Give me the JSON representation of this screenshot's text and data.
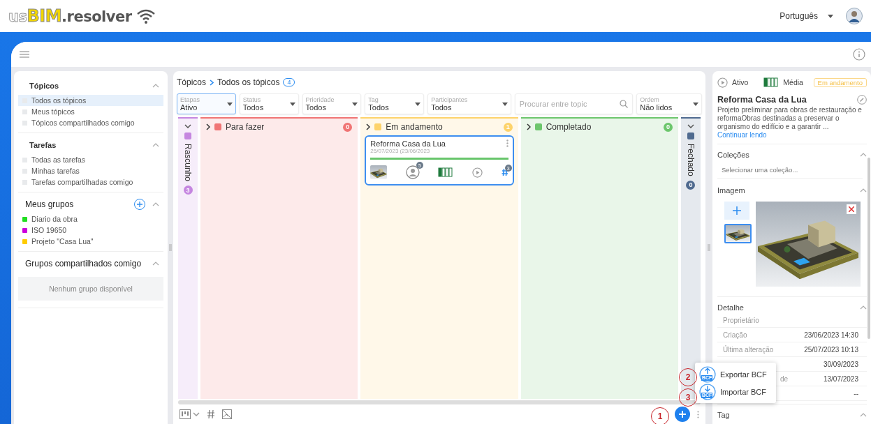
{
  "header": {
    "logo": {
      "prefix": "us",
      "brand": "BIM",
      "suffix": ".resolver"
    },
    "language": "Português"
  },
  "sidebar": {
    "sections": [
      {
        "title": "Tópicos",
        "items": [
          {
            "label": "Todos os tópicos",
            "selected": true
          },
          {
            "label": "Meus tópicos",
            "selected": false
          },
          {
            "label": "Tópicos compartilhados comigo",
            "selected": false
          }
        ]
      },
      {
        "title": "Tarefas",
        "items": [
          {
            "label": "Todas as tarefas",
            "selected": false
          },
          {
            "label": "Minhas tarefas",
            "selected": false
          },
          {
            "label": "Tarefas compartilhadas comigo",
            "selected": false
          }
        ]
      }
    ],
    "groups": {
      "title": "Meus grupos",
      "items": [
        {
          "label": "Diario da obra",
          "color": "#22dd22"
        },
        {
          "label": "ISO 19650",
          "color": "#cc00dd"
        },
        {
          "label": "Projeto \"Casa Lua\"",
          "color": "#ffcc00"
        }
      ]
    },
    "shared": {
      "title": "Grupos compartilhados comigo",
      "empty": "Nenhum grupo disponível"
    }
  },
  "board": {
    "breadcrumb": {
      "root": "Tópicos",
      "current": "Todos os tópicos",
      "count": "4"
    },
    "filters": [
      {
        "label": "Etapas",
        "value": "Ativo",
        "focused": true
      },
      {
        "label": "Status",
        "value": "Todos",
        "focused": false
      },
      {
        "label": "Prioridade",
        "value": "Todos",
        "focused": false
      },
      {
        "label": "Tag",
        "value": "Todos",
        "focused": false
      },
      {
        "label": "Participantes",
        "value": "Todos",
        "focused": false
      }
    ],
    "search": {
      "placeholder": "Procurar entre topic"
    },
    "sort": {
      "label": "Ordem",
      "value": "Não lidos"
    },
    "columns": [
      {
        "title": "Rascunho",
        "count": "3",
        "color": "#c586e0",
        "expanded": false
      },
      {
        "title": "Para fazer",
        "count": "0",
        "color": "#f07474",
        "expanded": true
      },
      {
        "title": "Em andamento",
        "count": "1",
        "color": "#fdd36b",
        "expanded": true,
        "cards": [
          {
            "title": "Reforma Casa da Lua",
            "dates": "25/07/2023 (23/06/2023",
            "level": 1,
            "participants": "5",
            "priority": {
              "level": 0.25
            },
            "tags": "3"
          }
        ]
      },
      {
        "title": "Completado",
        "count": "0",
        "color": "#6cc66c",
        "expanded": true
      },
      {
        "title": "Fechado",
        "count": "0",
        "color": "#4f6a8f",
        "expanded": false
      }
    ]
  },
  "callouts": [
    {
      "label": "1"
    },
    {
      "label": "2"
    },
    {
      "label": "3"
    }
  ],
  "menu": [
    {
      "label": "Exportar BCF",
      "icon_text": "BCF",
      "kind": "export"
    },
    {
      "label": "Importar BCF",
      "icon_text": "BCF",
      "kind": "import"
    }
  ],
  "detail": {
    "status": "Ativo",
    "priority": {
      "label": "Média",
      "level": 0.25
    },
    "stage": "Em andamento",
    "title": "Reforma Casa da Lua",
    "description": "Projeto preliminar para obras de restauração e reformaObras destinadas a preservar o organismo do edifício e a garantir ...",
    "link": "Continuar lendo",
    "collections": {
      "title": "Coleções",
      "placeholder": "Selecionar uma coleção..."
    },
    "image": {
      "title": "Imagem"
    },
    "details": {
      "title": "Detalhe",
      "rows": [
        {
          "label": "Proprietário"
        },
        {
          "label": "Criação",
          "value": "23/06/2023 14:30"
        },
        {
          "label": "Última alteração",
          "value": "25/07/2023 10:13"
        },
        {
          "value": "30/09/2023"
        },
        {
          "label": "de",
          "value": "13/07/2023",
          "kind": "partial"
        },
        {
          "value": "--"
        }
      ]
    },
    "tag": {
      "title": "Tag"
    }
  }
}
